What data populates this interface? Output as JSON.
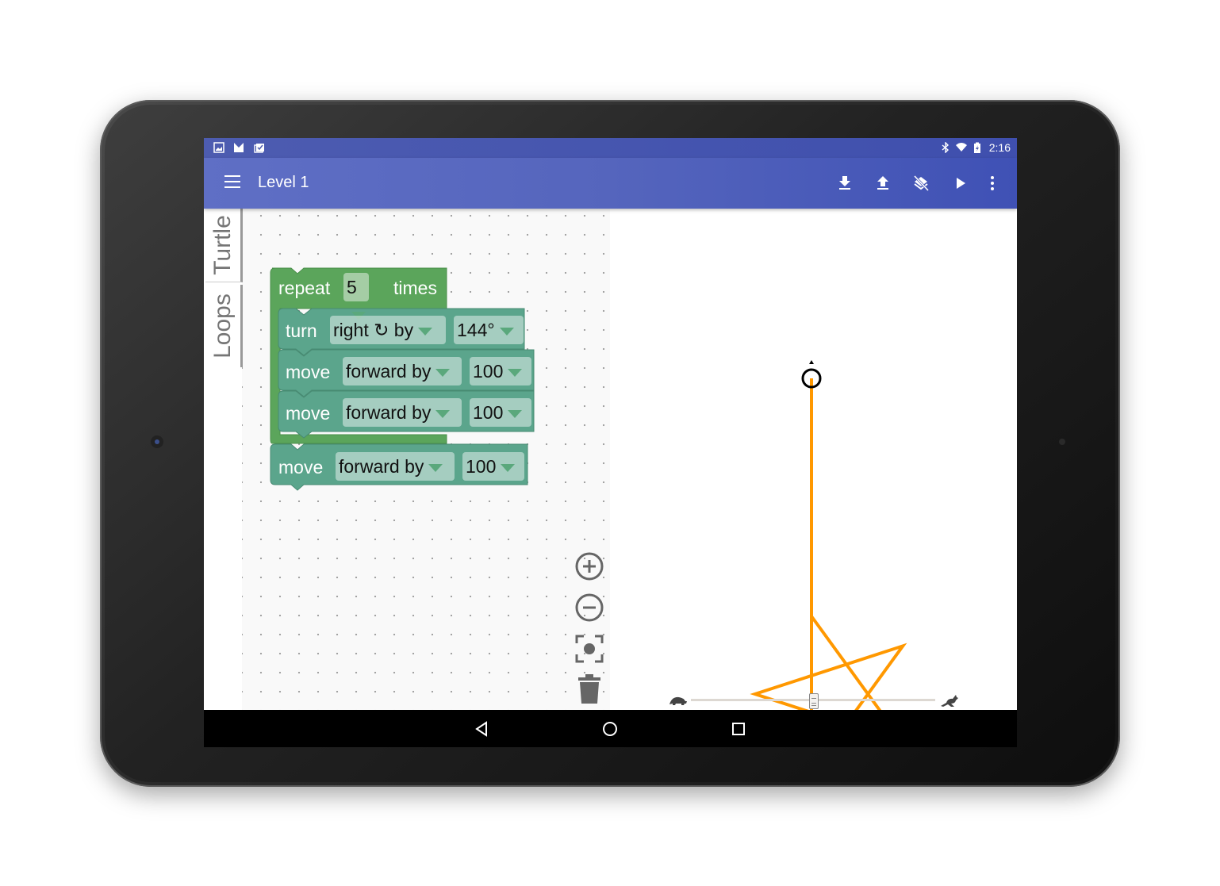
{
  "status_bar": {
    "left_icons": [
      "image-notification-icon",
      "gmail-icon",
      "clipboard-check-icon"
    ],
    "right_icons": [
      "bluetooth-icon",
      "wifi-icon",
      "battery-charging-icon"
    ],
    "time": "2:16"
  },
  "app_bar": {
    "menu_icon": "hamburger-menu-icon",
    "title": "Level 1",
    "actions": [
      {
        "name": "download",
        "icon": "download-icon"
      },
      {
        "name": "upload",
        "icon": "upload-icon"
      },
      {
        "name": "clear-layers",
        "icon": "layers-clear-icon"
      },
      {
        "name": "run",
        "icon": "play-icon"
      },
      {
        "name": "more",
        "icon": "more-vert-icon"
      }
    ]
  },
  "toolbox": {
    "tabs": [
      {
        "label": "Turtle"
      },
      {
        "label": "Loops"
      }
    ]
  },
  "blocks": {
    "repeat": {
      "label": "repeat",
      "count": "5",
      "suffix": "times"
    },
    "turn": {
      "label": "turn",
      "direction": "right ↻ by",
      "angle": "144°"
    },
    "move1": {
      "label": "move",
      "direction": "forward by",
      "distance": "100"
    },
    "move2": {
      "label": "move",
      "direction": "forward by",
      "distance": "100"
    },
    "move3": {
      "label": "move",
      "direction": "forward by",
      "distance": "100"
    }
  },
  "workspace_controls": [
    "zoom-in-icon",
    "zoom-out-icon",
    "recenter-icon",
    "trash-icon"
  ],
  "turtle_stage": {
    "pen_color": "#ff9800",
    "speed_slider": {
      "value_fraction": 0.5,
      "min_icon": "turtle-slow-icon",
      "max_icon": "rabbit-fast-icon"
    }
  },
  "colors": {
    "primary": "#3f51b5",
    "loop_block": "#5ba55b",
    "turtle_block": "#5ba58c"
  },
  "nav_bar": [
    "back-icon",
    "home-icon",
    "recents-icon"
  ]
}
